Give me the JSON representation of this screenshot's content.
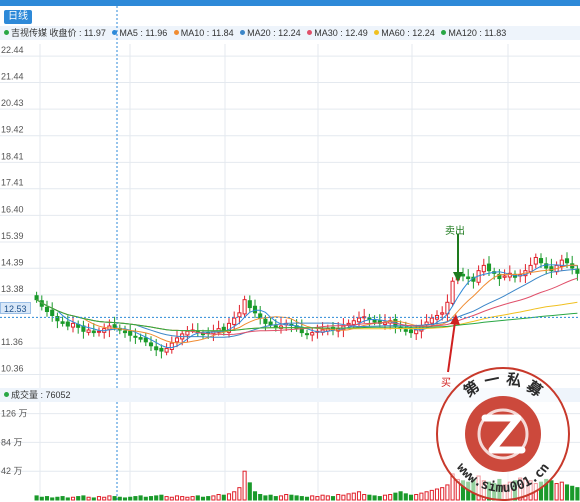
{
  "header": {
    "tab_label": "日线"
  },
  "legend": {
    "items": [
      {
        "text": "吉视传媒  收盘价 : 11.97",
        "color": "#29a745"
      },
      {
        "text": "MA5 : 11.96",
        "color": "#2d89d8"
      },
      {
        "text": "MA10 : 11.84",
        "color": "#f08c32"
      },
      {
        "text": "MA20 : 12.24",
        "color": "#3b86c8"
      },
      {
        "text": "MA30 : 12.49",
        "color": "#e0506a"
      },
      {
        "text": "MA60 : 12.24",
        "color": "#f0c020"
      },
      {
        "text": "MA120 : 11.83",
        "color": "#29a745"
      }
    ]
  },
  "price_tag": "12.53",
  "annotations": {
    "sell": "卖出",
    "buy": "买"
  },
  "volume": {
    "title": "成交量 : 76052"
  },
  "watermark": {
    "top_text": "第 一 私 募",
    "bottom_text": "www.simu001.cn"
  },
  "chart_data": [
    {
      "type": "candlestick",
      "y_ticks": [
        "22.44",
        "21.44",
        "20.43",
        "19.42",
        "18.41",
        "17.41",
        "16.40",
        "15.39",
        "14.39",
        "13.38",
        "12.53",
        "11.36",
        "10.36"
      ],
      "series": [
        {
          "name": "MA5",
          "color": "#2d89d8"
        },
        {
          "name": "MA10",
          "color": "#f08c32"
        },
        {
          "name": "MA20",
          "color": "#3b86c8"
        },
        {
          "name": "MA30",
          "color": "#e0506a"
        },
        {
          "name": "MA60",
          "color": "#f0c020"
        },
        {
          "name": "MA120",
          "color": "#29a745"
        }
      ],
      "colors": {
        "up": "#e0202a",
        "down": "#1a9a2a",
        "grid": "#e4e9ef",
        "crosshair": "#2d89d8"
      },
      "closes": [
        13.2,
        12.95,
        12.75,
        12.6,
        12.4,
        12.3,
        12.2,
        12.3,
        12.15,
        12.0,
        12.05,
        11.95,
        12.0,
        12.1,
        12.2,
        12.15,
        12.05,
        11.95,
        11.85,
        11.8,
        11.7,
        11.6,
        11.45,
        11.3,
        11.25,
        11.35,
        11.55,
        11.75,
        11.9,
        12.0,
        12.05,
        11.95,
        11.9,
        11.95,
        12.0,
        12.1,
        12.0,
        12.3,
        12.5,
        12.7,
        13.2,
        12.9,
        12.7,
        12.5,
        12.3,
        12.25,
        12.15,
        12.2,
        12.3,
        12.25,
        12.1,
        11.95,
        11.9,
        11.95,
        12.0,
        12.05,
        12.1,
        12.05,
        12.1,
        12.2,
        12.3,
        12.4,
        12.5,
        12.55,
        12.45,
        12.35,
        12.3,
        12.35,
        12.4,
        12.2,
        12.1,
        12.0,
        11.95,
        12.05,
        12.2,
        12.35,
        12.5,
        12.6,
        12.7,
        13.1,
        13.9,
        14.2,
        14.1,
        14.0,
        13.9,
        14.3,
        14.5,
        14.3,
        14.2,
        14.0,
        14.1,
        14.2,
        14.05,
        14.15,
        14.3,
        14.5,
        14.8,
        14.6,
        14.4,
        14.3,
        14.5,
        14.7,
        14.6,
        14.4,
        14.2
      ],
      "volumes": [
        6,
        4,
        5,
        3,
        4,
        5,
        3,
        4,
        5,
        6,
        4,
        3,
        5,
        4,
        6,
        5,
        4,
        3,
        4,
        5,
        6,
        4,
        5,
        6,
        7,
        5,
        4,
        6,
        5,
        4,
        5,
        6,
        4,
        5,
        6,
        8,
        7,
        9,
        12,
        18,
        42,
        25,
        12,
        8,
        6,
        7,
        5,
        6,
        8,
        7,
        6,
        5,
        4,
        6,
        5,
        7,
        6,
        5,
        8,
        7,
        9,
        10,
        12,
        8,
        7,
        6,
        5,
        7,
        8,
        10,
        12,
        9,
        7,
        8,
        10,
        12,
        14,
        16,
        18,
        22,
        38,
        30,
        28,
        26,
        30,
        35,
        28,
        26,
        24,
        30,
        22,
        26,
        28,
        32,
        30,
        28,
        24,
        26,
        30,
        28,
        24,
        26,
        22,
        20,
        18
      ],
      "volume_ticks": [
        "126 万",
        "84 万",
        "42 万"
      ]
    }
  ]
}
